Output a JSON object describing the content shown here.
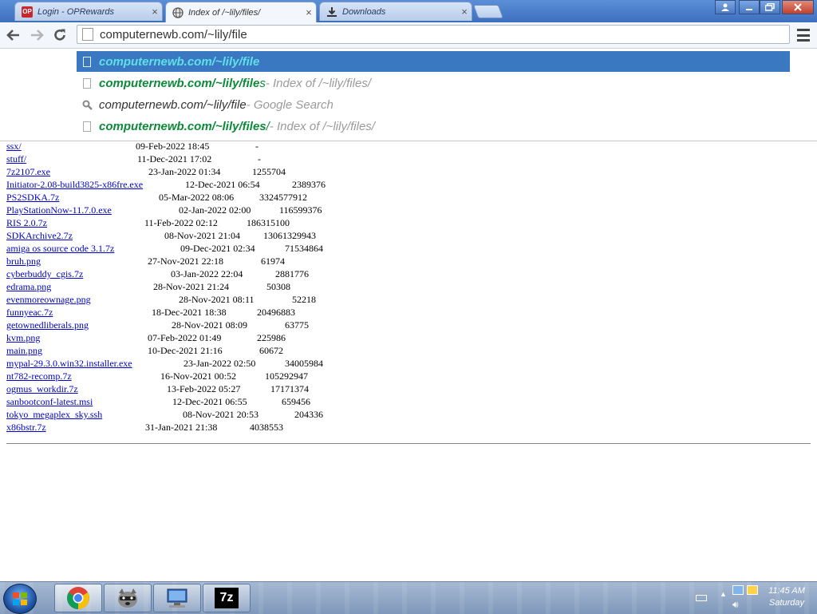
{
  "browser": {
    "tabs": [
      {
        "title": "Login - OPRewards",
        "favicon": "op-logo-icon",
        "favicon_text": "OP",
        "close": "×"
      },
      {
        "title": "Index of /~lily/files/",
        "favicon": "globe-icon",
        "close": "×",
        "active": true
      },
      {
        "title": "Downloads",
        "favicon": "download-icon",
        "close": "×"
      }
    ],
    "window_buttons": {
      "user": "user-icon",
      "minimize": "minimize-icon",
      "maximize": "maximize-icon",
      "close": "close-icon"
    }
  },
  "toolbar": {
    "back": "back-arrow-icon",
    "forward": "forward-arrow-icon",
    "reload": "reload-icon",
    "omnibox_value": "computernewb.com/~lily/file",
    "menu": "menu-icon"
  },
  "suggestions": [
    {
      "bold": "computernewb.com/~lily/file",
      "rest": "",
      "desc": "",
      "selected": true,
      "icon": "page-icon"
    },
    {
      "bold": "computernewb.com/~lily/file",
      "rest": "s",
      "desc": " - Index of /~lily/files/",
      "icon": "page-icon"
    },
    {
      "plain": "computernewb.com/~lily/file",
      "desc": " - Google Search",
      "icon": "search-icon"
    },
    {
      "bold": "computernewb.com/~lily/files",
      "rest": "/",
      "desc": " - Index of /~lily/files/",
      "icon": "page-icon"
    }
  ],
  "listing": [
    {
      "name": "ssx/",
      "date": "09-Feb-2022 18:45",
      "size": "-"
    },
    {
      "name": "stuff/",
      "date": "11-Dec-2021 17:02",
      "size": "-"
    },
    {
      "name": "7z2107.exe",
      "date": "23-Jan-2022 01:34",
      "size": "1255704"
    },
    {
      "name": "Initiator-2.08-build3825-x86fre.exe",
      "date": "12-Dec-2021 06:54",
      "size": "2389376"
    },
    {
      "name": "PS2SDKA.7z",
      "date": "05-Mar-2022 08:06",
      "size": "3324577912"
    },
    {
      "name": "PlayStationNow-11.7.0.exe",
      "date": "02-Jan-2022 02:00",
      "size": "116599376"
    },
    {
      "name": "RIS 2.0.7z",
      "date": "11-Feb-2022 02:12",
      "size": "186315100"
    },
    {
      "name": "SDKArchive2.7z",
      "date": "08-Nov-2021 21:04",
      "size": "13061329943"
    },
    {
      "name": "amiga os source code 3.1.7z",
      "date": "09-Dec-2021 02:34",
      "size": "71534864"
    },
    {
      "name": "bruh.png",
      "date": "27-Nov-2021 22:18",
      "size": "61974"
    },
    {
      "name": "cyberbuddy_cgis.7z",
      "date": "03-Jan-2022 22:04",
      "size": "2881776"
    },
    {
      "name": "edrama.png",
      "date": "28-Nov-2021 21:24",
      "size": "50308"
    },
    {
      "name": "evenmoreownage.png",
      "date": "28-Nov-2021 08:11",
      "size": "52218"
    },
    {
      "name": "funnyeac.7z",
      "date": "18-Dec-2021 18:38",
      "size": "20496883"
    },
    {
      "name": "getownedliberals.png",
      "date": "28-Nov-2021 08:09",
      "size": "63775"
    },
    {
      "name": "kvm.png",
      "date": "07-Feb-2022 01:49",
      "size": "225986"
    },
    {
      "name": "main.png",
      "date": "10-Dec-2021 21:16",
      "size": "60672"
    },
    {
      "name": "mypal-29.3.0.win32.installer.exe",
      "date": "23-Jan-2022 02:50",
      "size": "34005984"
    },
    {
      "name": "nt782-recomp.7z",
      "date": "16-Nov-2021 00:52",
      "size": "105292947"
    },
    {
      "name": "ogmus_workdir.7z",
      "date": "13-Feb-2022 05:27",
      "size": "17171374"
    },
    {
      "name": "sanbootconf-latest.msi",
      "date": "12-Dec-2021 06:55",
      "size": "659456"
    },
    {
      "name": "tokyo_megaplex_sky.ssh",
      "date": "08-Nov-2021 20:53",
      "size": "204336"
    },
    {
      "name": "x86bstr.7z",
      "date": "31-Jan-2021 21:38",
      "size": "4038553"
    }
  ],
  "taskbar": {
    "start": "windows-start-icon",
    "items": [
      "chrome-icon",
      "raccoon-icon",
      "computer-icon",
      "7zip-icon"
    ],
    "item_text": {
      "sevenzip": "7z"
    },
    "clock_time": "11:45 AM",
    "clock_day": "Saturday",
    "tray": [
      "keyboard-icon",
      "show-hidden-icons-icon",
      "network-icon",
      "action-center-icon",
      "volume-icon"
    ]
  }
}
